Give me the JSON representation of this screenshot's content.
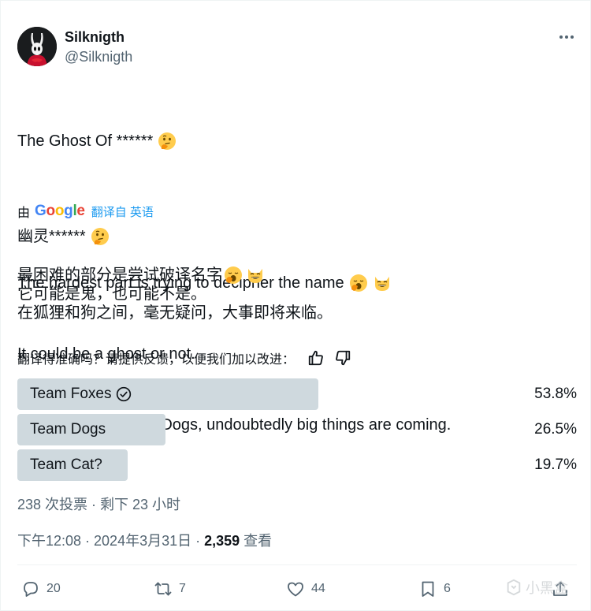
{
  "author": {
    "name": "Silknigth",
    "handle": "@Silknigth"
  },
  "tweet": {
    "lines": [
      "The Ghost Of ******",
      "",
      "The hardest part is trying to decipher the name",
      "It could be a ghost or not.",
      "Between Foxes and Dogs, undoubtedly big things are coming."
    ],
    "emoji": [
      "thinking-face",
      "yawning-face",
      "grinning-cat-face"
    ]
  },
  "translation": {
    "by_label": "由",
    "provider": "Google",
    "link_label": "翻译自 英语",
    "lines": [
      "幽灵******",
      "",
      "最困难的部分是尝试破译名字",
      "它可能是鬼，也可能不是。",
      "在狐狸和狗之间，毫无疑问，大事即将来临。"
    ],
    "feedback_prompt": "翻译得准确吗？请提供反馈，以便我们加以改进："
  },
  "poll": {
    "options": [
      {
        "label": "Team Foxes",
        "percent": "53.8%",
        "share": 53.8,
        "winner": true
      },
      {
        "label": "Team Dogs",
        "percent": "26.5%",
        "share": 26.5,
        "winner": false
      },
      {
        "label": "Team Cat?",
        "percent": "19.7%",
        "share": 19.7,
        "winner": false
      }
    ],
    "summary": "238 次投票 · 剩下 23 小时"
  },
  "meta": {
    "time": "下午12:08 · 2024年3月31日 · ",
    "views_count": "2,359",
    "views_label": " 查看"
  },
  "actions": {
    "replies": "20",
    "reposts": "7",
    "likes": "44",
    "bookmarks": "6"
  },
  "watermark": "小黑盒",
  "colors": {
    "text": "#0f1419",
    "secondary": "#536471",
    "link": "#1d9bf0",
    "poll_bar": "#cfd9de"
  }
}
